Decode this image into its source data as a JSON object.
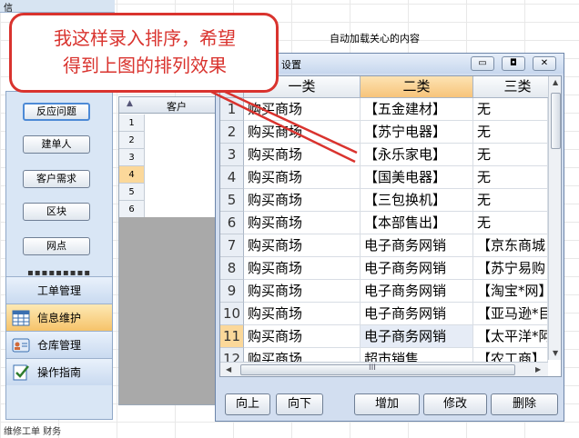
{
  "top_strip": "信",
  "header_title": "自动加载关心的内容",
  "callout": {
    "line1": "我这样录入排序，希望",
    "line2": "得到上图的排列效果"
  },
  "left_panel": {
    "buttons": [
      "反应问题",
      "建单人",
      "客户需求",
      "区块",
      "网点"
    ],
    "dots": "▪▪▪▪▪▪▪▪▪",
    "nav": [
      "工单管理",
      "信息维护",
      "仓库管理",
      "操作指南"
    ]
  },
  "bottom_text": "维修工单  财务",
  "mid_table": {
    "header": "客户",
    "row_numbers": [
      "1",
      "2",
      "3",
      "4",
      "5",
      "6"
    ]
  },
  "dialog": {
    "title": "设置",
    "window_buttons": [
      "▭",
      "◘",
      "✕"
    ],
    "columns": [
      "一类",
      "二类",
      "三类"
    ],
    "rows": [
      {
        "n": "1",
        "c1": "购买商场",
        "c2": "【五金建材】",
        "c3": "无"
      },
      {
        "n": "2",
        "c1": "购买商场",
        "c2": "【苏宁电器】",
        "c3": "无"
      },
      {
        "n": "3",
        "c1": "购买商场",
        "c2": "【永乐家电】",
        "c3": "无"
      },
      {
        "n": "4",
        "c1": "购买商场",
        "c2": "【国美电器】",
        "c3": "无"
      },
      {
        "n": "5",
        "c1": "购买商场",
        "c2": "【三包换机】",
        "c3": "无"
      },
      {
        "n": "6",
        "c1": "购买商场",
        "c2": "【本部售出】",
        "c3": "无"
      },
      {
        "n": "7",
        "c1": "购买商场",
        "c2": "电子商务网销",
        "c3": "【京东商城"
      },
      {
        "n": "8",
        "c1": "购买商场",
        "c2": "电子商务网销",
        "c3": "【苏宁易购"
      },
      {
        "n": "9",
        "c1": "购买商场",
        "c2": "电子商务网销",
        "c3": "【淘宝*网】"
      },
      {
        "n": "10",
        "c1": "购买商场",
        "c2": "电子商务网销",
        "c3": "【亚马逊*目"
      },
      {
        "n": "11",
        "c1": "购买商场",
        "c2": "电子商务网销",
        "c3": "【太平洋*阿"
      },
      {
        "n": "12",
        "c1": "购买商场",
        "c2": "超市销售",
        "c3": "【农工商】"
      }
    ],
    "buttons": [
      "向上",
      "向下",
      "增加",
      "修改",
      "删除"
    ],
    "hscroll_grip": "III"
  },
  "colors": {
    "callout_red": "#d9332e",
    "selection_orange": "#fbd89a",
    "panel_blue": "#d9e6f5"
  }
}
